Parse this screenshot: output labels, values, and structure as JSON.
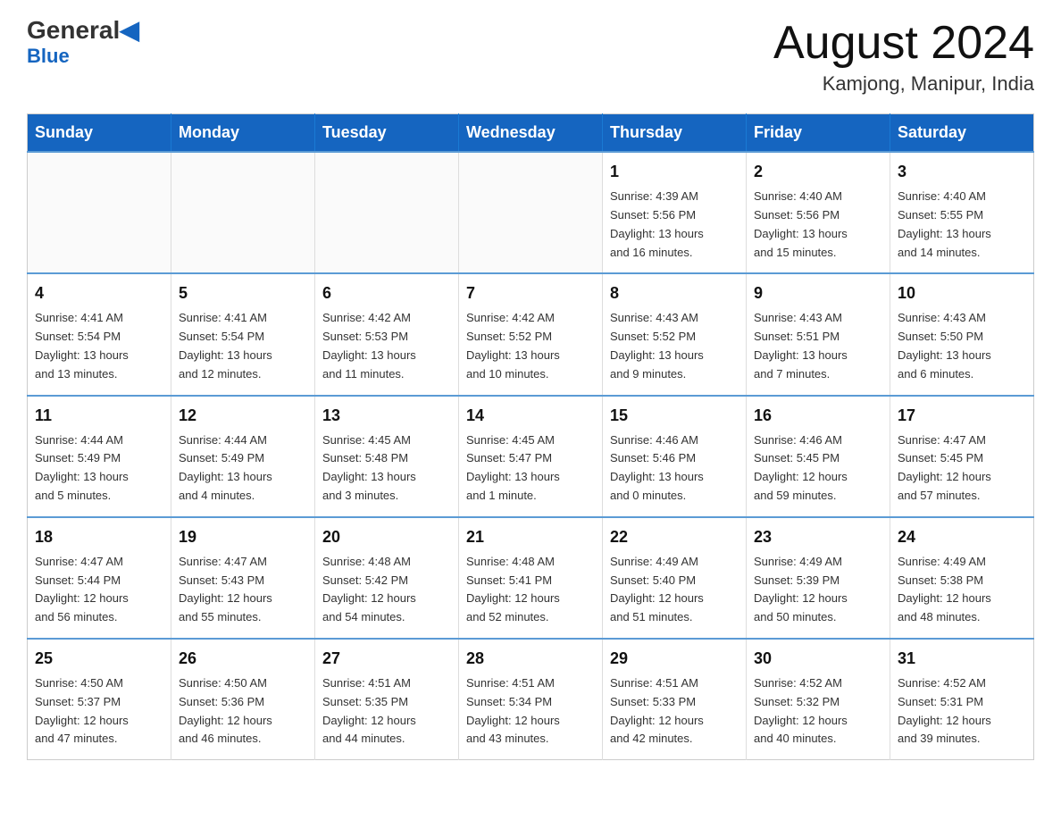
{
  "header": {
    "logo_top": "General",
    "logo_bottom": "Blue",
    "month_title": "August 2024",
    "location": "Kamjong, Manipur, India"
  },
  "days_of_week": [
    "Sunday",
    "Monday",
    "Tuesday",
    "Wednesday",
    "Thursday",
    "Friday",
    "Saturday"
  ],
  "weeks": [
    [
      {
        "day": "",
        "info": ""
      },
      {
        "day": "",
        "info": ""
      },
      {
        "day": "",
        "info": ""
      },
      {
        "day": "",
        "info": ""
      },
      {
        "day": "1",
        "info": "Sunrise: 4:39 AM\nSunset: 5:56 PM\nDaylight: 13 hours\nand 16 minutes."
      },
      {
        "day": "2",
        "info": "Sunrise: 4:40 AM\nSunset: 5:56 PM\nDaylight: 13 hours\nand 15 minutes."
      },
      {
        "day": "3",
        "info": "Sunrise: 4:40 AM\nSunset: 5:55 PM\nDaylight: 13 hours\nand 14 minutes."
      }
    ],
    [
      {
        "day": "4",
        "info": "Sunrise: 4:41 AM\nSunset: 5:54 PM\nDaylight: 13 hours\nand 13 minutes."
      },
      {
        "day": "5",
        "info": "Sunrise: 4:41 AM\nSunset: 5:54 PM\nDaylight: 13 hours\nand 12 minutes."
      },
      {
        "day": "6",
        "info": "Sunrise: 4:42 AM\nSunset: 5:53 PM\nDaylight: 13 hours\nand 11 minutes."
      },
      {
        "day": "7",
        "info": "Sunrise: 4:42 AM\nSunset: 5:52 PM\nDaylight: 13 hours\nand 10 minutes."
      },
      {
        "day": "8",
        "info": "Sunrise: 4:43 AM\nSunset: 5:52 PM\nDaylight: 13 hours\nand 9 minutes."
      },
      {
        "day": "9",
        "info": "Sunrise: 4:43 AM\nSunset: 5:51 PM\nDaylight: 13 hours\nand 7 minutes."
      },
      {
        "day": "10",
        "info": "Sunrise: 4:43 AM\nSunset: 5:50 PM\nDaylight: 13 hours\nand 6 minutes."
      }
    ],
    [
      {
        "day": "11",
        "info": "Sunrise: 4:44 AM\nSunset: 5:49 PM\nDaylight: 13 hours\nand 5 minutes."
      },
      {
        "day": "12",
        "info": "Sunrise: 4:44 AM\nSunset: 5:49 PM\nDaylight: 13 hours\nand 4 minutes."
      },
      {
        "day": "13",
        "info": "Sunrise: 4:45 AM\nSunset: 5:48 PM\nDaylight: 13 hours\nand 3 minutes."
      },
      {
        "day": "14",
        "info": "Sunrise: 4:45 AM\nSunset: 5:47 PM\nDaylight: 13 hours\nand 1 minute."
      },
      {
        "day": "15",
        "info": "Sunrise: 4:46 AM\nSunset: 5:46 PM\nDaylight: 13 hours\nand 0 minutes."
      },
      {
        "day": "16",
        "info": "Sunrise: 4:46 AM\nSunset: 5:45 PM\nDaylight: 12 hours\nand 59 minutes."
      },
      {
        "day": "17",
        "info": "Sunrise: 4:47 AM\nSunset: 5:45 PM\nDaylight: 12 hours\nand 57 minutes."
      }
    ],
    [
      {
        "day": "18",
        "info": "Sunrise: 4:47 AM\nSunset: 5:44 PM\nDaylight: 12 hours\nand 56 minutes."
      },
      {
        "day": "19",
        "info": "Sunrise: 4:47 AM\nSunset: 5:43 PM\nDaylight: 12 hours\nand 55 minutes."
      },
      {
        "day": "20",
        "info": "Sunrise: 4:48 AM\nSunset: 5:42 PM\nDaylight: 12 hours\nand 54 minutes."
      },
      {
        "day": "21",
        "info": "Sunrise: 4:48 AM\nSunset: 5:41 PM\nDaylight: 12 hours\nand 52 minutes."
      },
      {
        "day": "22",
        "info": "Sunrise: 4:49 AM\nSunset: 5:40 PM\nDaylight: 12 hours\nand 51 minutes."
      },
      {
        "day": "23",
        "info": "Sunrise: 4:49 AM\nSunset: 5:39 PM\nDaylight: 12 hours\nand 50 minutes."
      },
      {
        "day": "24",
        "info": "Sunrise: 4:49 AM\nSunset: 5:38 PM\nDaylight: 12 hours\nand 48 minutes."
      }
    ],
    [
      {
        "day": "25",
        "info": "Sunrise: 4:50 AM\nSunset: 5:37 PM\nDaylight: 12 hours\nand 47 minutes."
      },
      {
        "day": "26",
        "info": "Sunrise: 4:50 AM\nSunset: 5:36 PM\nDaylight: 12 hours\nand 46 minutes."
      },
      {
        "day": "27",
        "info": "Sunrise: 4:51 AM\nSunset: 5:35 PM\nDaylight: 12 hours\nand 44 minutes."
      },
      {
        "day": "28",
        "info": "Sunrise: 4:51 AM\nSunset: 5:34 PM\nDaylight: 12 hours\nand 43 minutes."
      },
      {
        "day": "29",
        "info": "Sunrise: 4:51 AM\nSunset: 5:33 PM\nDaylight: 12 hours\nand 42 minutes."
      },
      {
        "day": "30",
        "info": "Sunrise: 4:52 AM\nSunset: 5:32 PM\nDaylight: 12 hours\nand 40 minutes."
      },
      {
        "day": "31",
        "info": "Sunrise: 4:52 AM\nSunset: 5:31 PM\nDaylight: 12 hours\nand 39 minutes."
      }
    ]
  ]
}
